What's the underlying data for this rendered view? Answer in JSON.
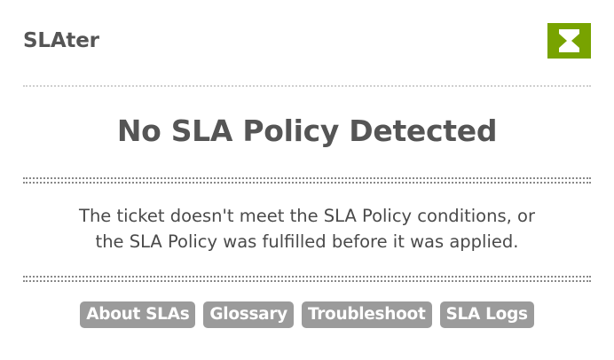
{
  "app": {
    "title": "SLAter",
    "logo_icon": "hourglass-icon",
    "logo_color": "#78a300"
  },
  "status": {
    "headline": "No SLA Policy Detected",
    "message_lines": [
      "The ticket doesn't meet the SLA Policy conditions, or",
      "the SLA Policy was fulfilled before it was applied."
    ]
  },
  "links": [
    {
      "label": "About SLAs"
    },
    {
      "label": "Glossary"
    },
    {
      "label": "Troubleshoot"
    },
    {
      "label": "SLA Logs"
    }
  ],
  "colors": {
    "button_bg": "#9b9b9b",
    "text": "#555555"
  }
}
